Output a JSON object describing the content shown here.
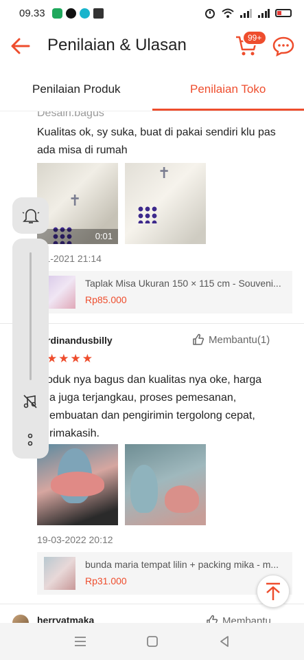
{
  "status_bar": {
    "time": "09.33"
  },
  "header": {
    "title": "Penilaian & Ulasan",
    "cart_badge": "99+"
  },
  "tabs": [
    {
      "label": "Penilaian Produk",
      "active": false
    },
    {
      "label": "Penilaian Toko",
      "active": true
    }
  ],
  "reviews": [
    {
      "clipped_top_text": "Desain:bagus",
      "text_lines": [
        "Kualitas ok, sy suka, buat di pakai sendiri klu pas",
        "ada misa di rumah"
      ],
      "video_duration": "0:01",
      "date": "-11-2021 21:14",
      "product": {
        "name": "Taplak Misa Ukuran 150 × 115 cm - Souveni...",
        "price": "Rp85.000"
      }
    },
    {
      "reviewer": "rdinandusbilly",
      "helpful": "Membantu(1)",
      "stars": "★★★★",
      "text_lines": [
        "oduk nya bagus dan kualitas nya oke, harga",
        "a juga terjangkau, proses pemesanan,",
        "embuatan dan pengirimin tergolong cepat,",
        "rimakasih."
      ],
      "date": "19-03-2022 20:12",
      "product": {
        "name": "bunda maria tempat lilin + packing mika - m...",
        "price": "Rp31.000"
      }
    },
    {
      "reviewer": "herryatmaka",
      "helpful": "Membantu"
    }
  ],
  "colors": {
    "accent": "#ee4d2d"
  },
  "icons": [
    "back-arrow-icon",
    "cart-icon",
    "chat-icon",
    "thumbs-up-icon",
    "bell-icon",
    "music-off-icon",
    "more-icon",
    "arrow-up-icon"
  ]
}
